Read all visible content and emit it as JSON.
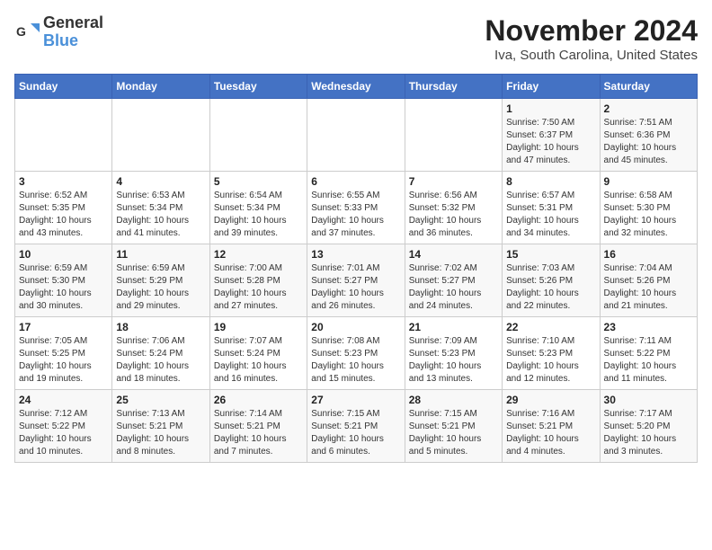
{
  "header": {
    "logo_general": "General",
    "logo_blue": "Blue",
    "title": "November 2024",
    "location": "Iva, South Carolina, United States"
  },
  "calendar": {
    "days_of_week": [
      "Sunday",
      "Monday",
      "Tuesday",
      "Wednesday",
      "Thursday",
      "Friday",
      "Saturday"
    ],
    "weeks": [
      [
        {
          "day": "",
          "info": ""
        },
        {
          "day": "",
          "info": ""
        },
        {
          "day": "",
          "info": ""
        },
        {
          "day": "",
          "info": ""
        },
        {
          "day": "",
          "info": ""
        },
        {
          "day": "1",
          "info": "Sunrise: 7:50 AM\nSunset: 6:37 PM\nDaylight: 10 hours\nand 47 minutes."
        },
        {
          "day": "2",
          "info": "Sunrise: 7:51 AM\nSunset: 6:36 PM\nDaylight: 10 hours\nand 45 minutes."
        }
      ],
      [
        {
          "day": "3",
          "info": "Sunrise: 6:52 AM\nSunset: 5:35 PM\nDaylight: 10 hours\nand 43 minutes."
        },
        {
          "day": "4",
          "info": "Sunrise: 6:53 AM\nSunset: 5:34 PM\nDaylight: 10 hours\nand 41 minutes."
        },
        {
          "day": "5",
          "info": "Sunrise: 6:54 AM\nSunset: 5:34 PM\nDaylight: 10 hours\nand 39 minutes."
        },
        {
          "day": "6",
          "info": "Sunrise: 6:55 AM\nSunset: 5:33 PM\nDaylight: 10 hours\nand 37 minutes."
        },
        {
          "day": "7",
          "info": "Sunrise: 6:56 AM\nSunset: 5:32 PM\nDaylight: 10 hours\nand 36 minutes."
        },
        {
          "day": "8",
          "info": "Sunrise: 6:57 AM\nSunset: 5:31 PM\nDaylight: 10 hours\nand 34 minutes."
        },
        {
          "day": "9",
          "info": "Sunrise: 6:58 AM\nSunset: 5:30 PM\nDaylight: 10 hours\nand 32 minutes."
        }
      ],
      [
        {
          "day": "10",
          "info": "Sunrise: 6:59 AM\nSunset: 5:30 PM\nDaylight: 10 hours\nand 30 minutes."
        },
        {
          "day": "11",
          "info": "Sunrise: 6:59 AM\nSunset: 5:29 PM\nDaylight: 10 hours\nand 29 minutes."
        },
        {
          "day": "12",
          "info": "Sunrise: 7:00 AM\nSunset: 5:28 PM\nDaylight: 10 hours\nand 27 minutes."
        },
        {
          "day": "13",
          "info": "Sunrise: 7:01 AM\nSunset: 5:27 PM\nDaylight: 10 hours\nand 26 minutes."
        },
        {
          "day": "14",
          "info": "Sunrise: 7:02 AM\nSunset: 5:27 PM\nDaylight: 10 hours\nand 24 minutes."
        },
        {
          "day": "15",
          "info": "Sunrise: 7:03 AM\nSunset: 5:26 PM\nDaylight: 10 hours\nand 22 minutes."
        },
        {
          "day": "16",
          "info": "Sunrise: 7:04 AM\nSunset: 5:26 PM\nDaylight: 10 hours\nand 21 minutes."
        }
      ],
      [
        {
          "day": "17",
          "info": "Sunrise: 7:05 AM\nSunset: 5:25 PM\nDaylight: 10 hours\nand 19 minutes."
        },
        {
          "day": "18",
          "info": "Sunrise: 7:06 AM\nSunset: 5:24 PM\nDaylight: 10 hours\nand 18 minutes."
        },
        {
          "day": "19",
          "info": "Sunrise: 7:07 AM\nSunset: 5:24 PM\nDaylight: 10 hours\nand 16 minutes."
        },
        {
          "day": "20",
          "info": "Sunrise: 7:08 AM\nSunset: 5:23 PM\nDaylight: 10 hours\nand 15 minutes."
        },
        {
          "day": "21",
          "info": "Sunrise: 7:09 AM\nSunset: 5:23 PM\nDaylight: 10 hours\nand 13 minutes."
        },
        {
          "day": "22",
          "info": "Sunrise: 7:10 AM\nSunset: 5:23 PM\nDaylight: 10 hours\nand 12 minutes."
        },
        {
          "day": "23",
          "info": "Sunrise: 7:11 AM\nSunset: 5:22 PM\nDaylight: 10 hours\nand 11 minutes."
        }
      ],
      [
        {
          "day": "24",
          "info": "Sunrise: 7:12 AM\nSunset: 5:22 PM\nDaylight: 10 hours\nand 10 minutes."
        },
        {
          "day": "25",
          "info": "Sunrise: 7:13 AM\nSunset: 5:21 PM\nDaylight: 10 hours\nand 8 minutes."
        },
        {
          "day": "26",
          "info": "Sunrise: 7:14 AM\nSunset: 5:21 PM\nDaylight: 10 hours\nand 7 minutes."
        },
        {
          "day": "27",
          "info": "Sunrise: 7:15 AM\nSunset: 5:21 PM\nDaylight: 10 hours\nand 6 minutes."
        },
        {
          "day": "28",
          "info": "Sunrise: 7:15 AM\nSunset: 5:21 PM\nDaylight: 10 hours\nand 5 minutes."
        },
        {
          "day": "29",
          "info": "Sunrise: 7:16 AM\nSunset: 5:21 PM\nDaylight: 10 hours\nand 4 minutes."
        },
        {
          "day": "30",
          "info": "Sunrise: 7:17 AM\nSunset: 5:20 PM\nDaylight: 10 hours\nand 3 minutes."
        }
      ]
    ]
  }
}
